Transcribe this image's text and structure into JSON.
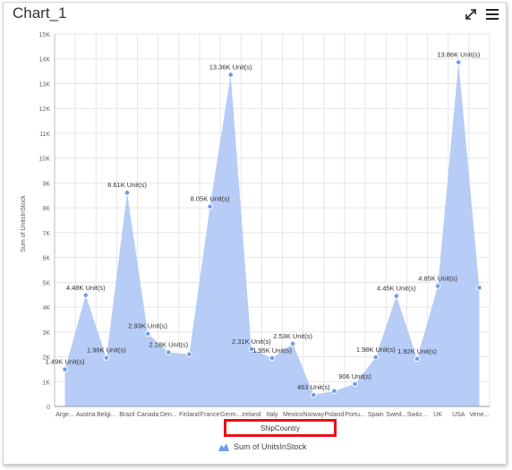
{
  "widget": {
    "title": "Chart_1"
  },
  "icons": {
    "expand": "expand-icon",
    "menu": "hamburger-menu-icon"
  },
  "colors": {
    "area_fill": "#b3c9f5",
    "marker": "#6f9af0",
    "highlight": "#e8101a"
  },
  "chart_data": {
    "type": "area",
    "xlabel": "ShipCountry",
    "ylabel": "Sum of UnitsInStock",
    "ylim": [
      0,
      15000
    ],
    "yticks": [
      "0",
      "1K",
      "2K",
      "3K",
      "4K",
      "5K",
      "6K",
      "7K",
      "8K",
      "9K",
      "10K",
      "11K",
      "12K",
      "13K",
      "14K",
      "15K"
    ],
    "categories": [
      "Arge...",
      "Austria",
      "Belgi...",
      "Brazil",
      "Canada",
      "Den...",
      "Finland",
      "France",
      "Germ...",
      "Ireland",
      "Italy",
      "Mexico",
      "Norway",
      "Poland",
      "Portu...",
      "Spain",
      "Swed...",
      "Switz...",
      "UK",
      "USA",
      "Vene..."
    ],
    "series": [
      {
        "name": "Sum of UnitsInStock",
        "values": [
          1490,
          4480,
          1960,
          8610,
          2930,
          2180,
          2100,
          8050,
          13360,
          2310,
          1950,
          2530,
          463,
          620,
          906,
          1980,
          4450,
          1920,
          4850,
          13860,
          4780
        ],
        "labels": [
          "1.49K Unit(s)",
          "4.48K Unit(s)",
          "1.96K Unit(s)",
          "8.61K Unit(s)",
          "2.93K Unit(s)",
          "2.18K Unit(s)",
          "",
          "8.05K Unit(s)",
          "13.36K Unit(s)",
          "2.31K Unit(s)",
          "1.95K Unit(s)",
          "2.53K Unit(s)",
          "463 Unit(s)",
          "",
          "906 Unit(s)",
          "1.98K Unit(s)",
          "4.45K Unit(s)",
          "1.92K Unit(s)",
          "4.85K Unit(s)",
          "13.86K Unit(s)",
          ""
        ]
      }
    ],
    "grid": true,
    "legend": "bottom-center"
  }
}
